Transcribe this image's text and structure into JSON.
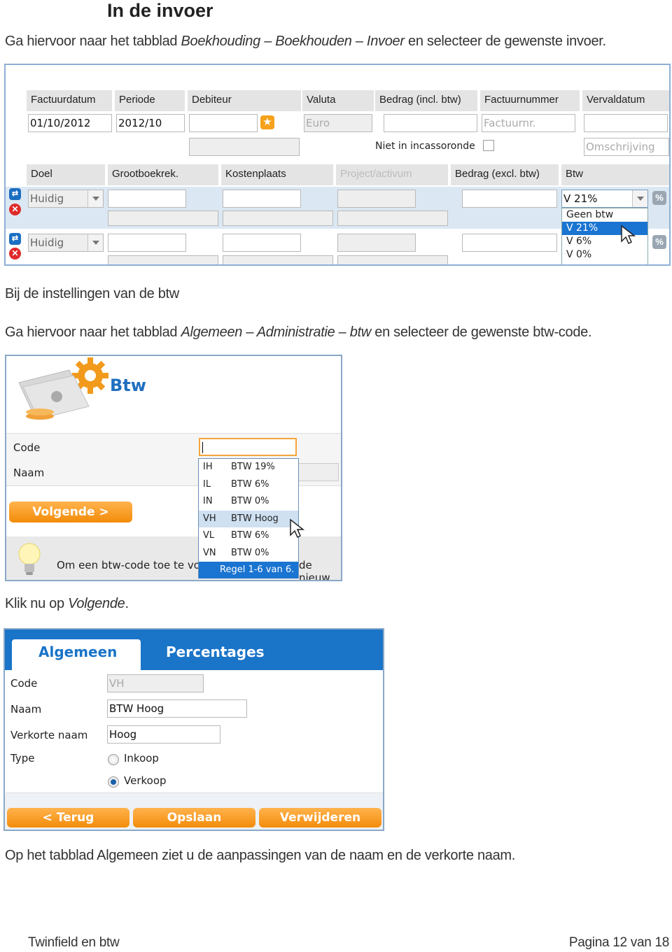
{
  "heading": "In de invoer",
  "intro1": {
    "pre": "Ga hiervoor naar het tabblad ",
    "path": "Boekhouding – Boekhouden – Invoer",
    "post": " en selecteer de gewenste invoer."
  },
  "invoer_screen": {
    "headers": [
      "Factuurdatum",
      "Periode",
      "Debiteur",
      "Valuta",
      "Bedrag (incl. btw)",
      "Factuurnummer",
      "Vervaldatum"
    ],
    "factuurdatum": "01/10/2012",
    "periode": "2012/10",
    "valuta": "Euro",
    "factuurnummer_placeholder": "Factuurnr.",
    "omschrijving_placeholder": "Omschrijving",
    "niet_in_incassoronde": "Niet in incassoronde",
    "line_headers": [
      "Doel",
      "Grootboekrek.",
      "Kostenplaats",
      "Project/activum",
      "Bedrag (excl. btw)",
      "Btw"
    ],
    "doel_value": "Huidig",
    "btw_value": "V 21%",
    "pct_symbol": "%",
    "btw_options": [
      "Geen btw",
      "V 21%",
      "V 6%",
      "V 0%"
    ],
    "btw_selected": "V 21%"
  },
  "section2_title": "Bij de instellingen van de btw",
  "intro2": {
    "pre": "Ga hiervoor naar het tabblad ",
    "path": "Algemeen – Administratie – btw",
    "post": " en selecteer de gewenste btw-code."
  },
  "btw_screen": {
    "title": "Btw",
    "code_label": "Code",
    "naam_label": "Naam",
    "next_button": "Volgende >",
    "tip_left": "Om een btw-code toe te vo",
    "tip_right": "de nieuw",
    "codes": [
      {
        "code": "IH",
        "name": "BTW 19%"
      },
      {
        "code": "IL",
        "name": "BTW 6%"
      },
      {
        "code": "IN",
        "name": "BTW 0%"
      },
      {
        "code": "VH",
        "name": "BTW Hoog"
      },
      {
        "code": "VL",
        "name": "BTW 6%"
      },
      {
        "code": "VN",
        "name": "BTW 0%"
      }
    ],
    "highlighted_code": "VH",
    "footer": "Regel 1-6 van 6."
  },
  "klik": {
    "pre": "Klik nu op ",
    "em": "Volgende",
    "post": "."
  },
  "detail_screen": {
    "tabs": [
      "Algemeen",
      "Percentages"
    ],
    "code_label": "Code",
    "code_value": "VH",
    "naam_label": "Naam",
    "naam_value": "BTW Hoog",
    "verkort_label": "Verkorte naam",
    "verkort_value": "Hoog",
    "type_label": "Type",
    "type_options": [
      "Inkoop",
      "Verkoop"
    ],
    "type_selected": "Verkoop",
    "buttons": [
      "< Terug",
      "Opslaan",
      "Verwijderen"
    ]
  },
  "closing": "Op het tabblad Algemeen ziet u de aanpassingen van de naam en de verkorte naam.",
  "footer": {
    "left": "Twinfield en btw",
    "right": "Pagina 12 van 18"
  },
  "colors": {
    "accent_blue": "#1a74d1",
    "orange": "#f38c0a",
    "frame": "#8fb0d4"
  }
}
